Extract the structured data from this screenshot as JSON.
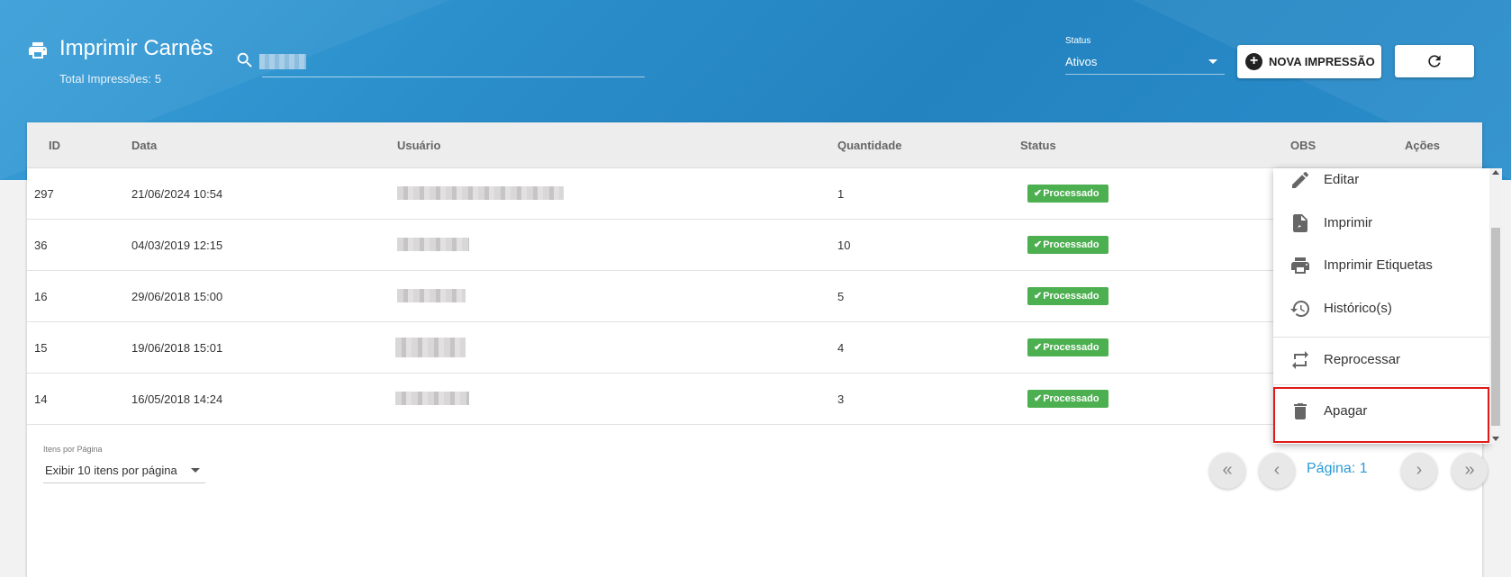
{
  "header": {
    "title": "Imprimir Carnês",
    "total_label": "Total Impressões:",
    "total_count": "5",
    "search": {
      "value": "",
      "placeholder": ""
    },
    "status": {
      "label": "Status",
      "value": "Ativos"
    },
    "new_button_label": "NOVA IMPRESSÃO",
    "icons": {
      "title": "printer-icon",
      "search": "search-icon",
      "new": "plus-circle-icon",
      "refresh": "refresh-icon"
    }
  },
  "table": {
    "columns": [
      "ID",
      "Data",
      "Usuário",
      "Quantidade",
      "Status",
      "OBS",
      "Ações"
    ],
    "rows": [
      {
        "id": "297",
        "date": "21/06/2024 10:54",
        "user": "",
        "quantity": "1",
        "status": "Processado"
      },
      {
        "id": "36",
        "date": "04/03/2019 12:15",
        "user": "",
        "quantity": "10",
        "status": "Processado"
      },
      {
        "id": "16",
        "date": "29/06/2018 15:00",
        "user": "",
        "quantity": "5",
        "status": "Processado"
      },
      {
        "id": "15",
        "date": "19/06/2018 15:01",
        "user": "",
        "quantity": "4",
        "status": "Processado"
      },
      {
        "id": "14",
        "date": "16/05/2018 14:24",
        "user": "",
        "quantity": "3",
        "status": "Processado"
      }
    ],
    "status_color": "#4caf50"
  },
  "pagination": {
    "per_page_label": "Itens por Página",
    "per_page_value": "Exibir 10 itens por página",
    "page_label": "Página: 1",
    "buttons": [
      "first-page-icon",
      "prev-page-icon",
      "next-page-icon",
      "last-page-icon"
    ]
  },
  "actions_menu": {
    "items": [
      {
        "label": "Editar",
        "icon": "pencil-icon"
      },
      {
        "label": "Imprimir",
        "icon": "pdf-icon"
      },
      {
        "label": "Imprimir Etiquetas",
        "icon": "printer-icon"
      },
      {
        "label": "Histórico(s)",
        "icon": "history-icon"
      },
      {
        "label": "Reprocessar",
        "icon": "repeat-icon"
      },
      {
        "label": "Apagar",
        "icon": "trash-icon"
      }
    ],
    "highlighted_item": "Apagar",
    "highlight_color": "#e01919"
  },
  "colors": {
    "banner": "#2a8ecb",
    "accent": "#2b9ad6"
  }
}
